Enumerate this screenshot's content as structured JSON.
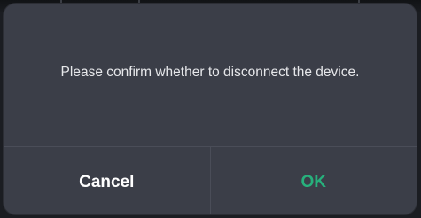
{
  "dialog": {
    "message": "Please confirm whether to disconnect the device.",
    "cancel_label": "Cancel",
    "ok_label": "OK"
  },
  "colors": {
    "dialog_background": "#3b3e48",
    "ok_accent": "#27b07c",
    "cancel_text": "#ffffff",
    "message_text": "#e6e7ea"
  }
}
